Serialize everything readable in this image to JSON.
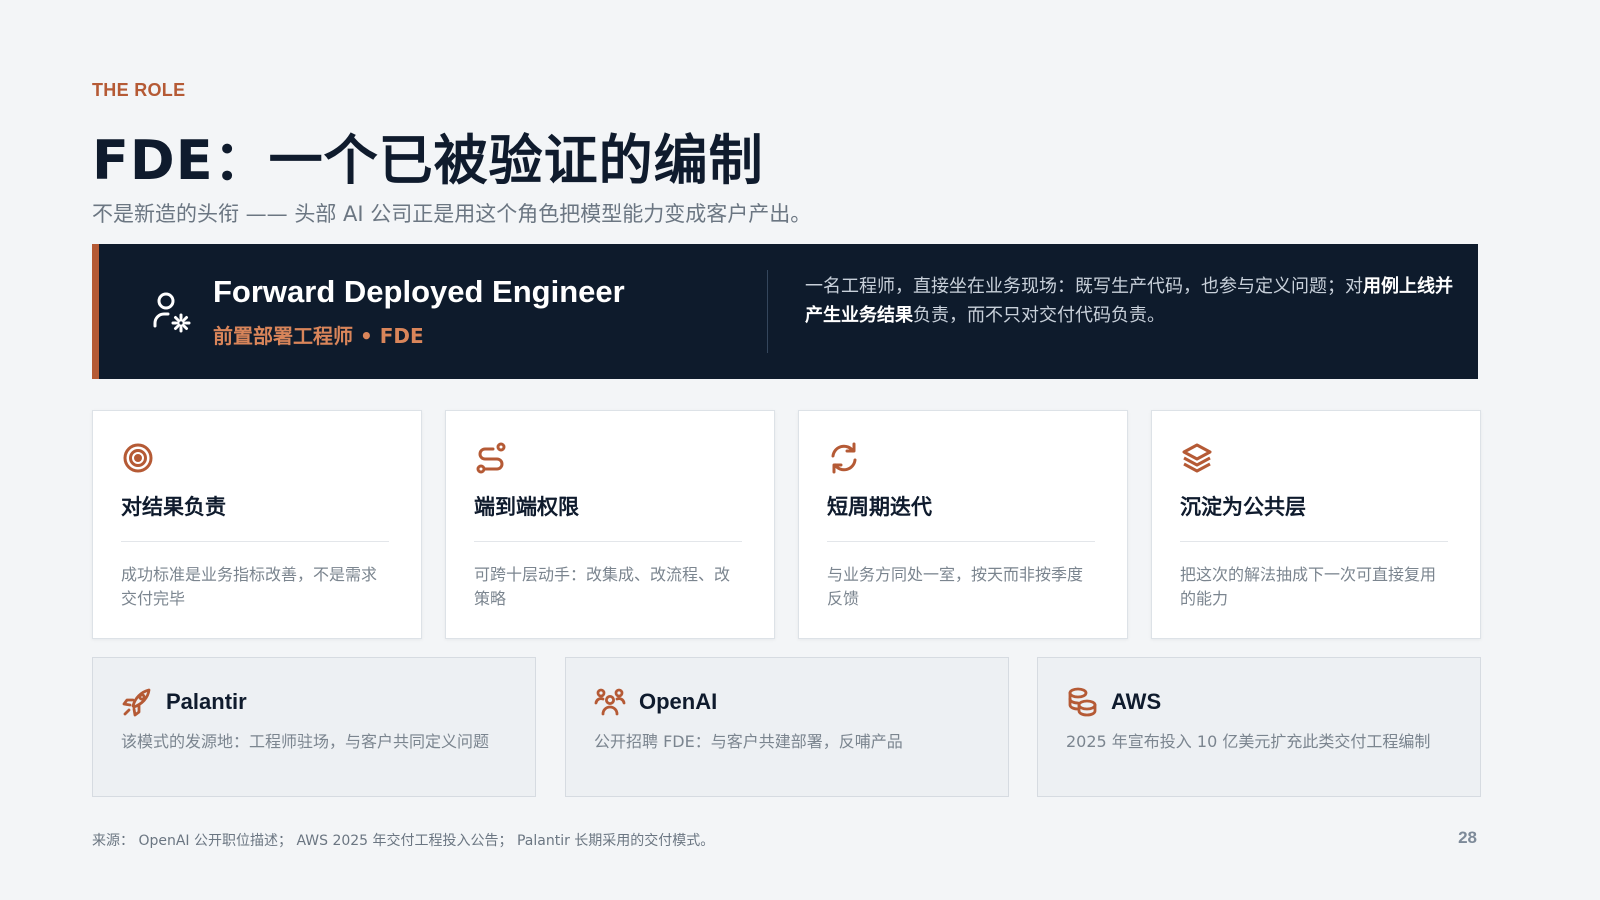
{
  "header": {
    "eyebrow": "THE ROLE",
    "title": "FDE：一个已被验证的编制",
    "subtitle": "不是新造的头衔 —— 头部 AI 公司正是用这个角色把模型能力变成客户产出。"
  },
  "banner": {
    "icon": "user-gear-icon",
    "name": "Forward Deployed Engineer",
    "sub": "前置部署工程师 • FDE",
    "desc_lead": "一名工程师，直接坐在业务现场：既写生产代码，也参与定义问题；对",
    "desc_emph": "用例上线并产生业务结果",
    "desc_tail": "负责，而不只对交付代码负责。"
  },
  "pillars": [
    {
      "icon": "target-icon",
      "title": "对结果负责",
      "desc": "成功标准是业务指标改善，不是需求交付完毕"
    },
    {
      "icon": "route-icon",
      "title": "端到端权限",
      "desc": "可跨十层动手：改集成、改流程、改策略"
    },
    {
      "icon": "refresh-icon",
      "title": "短周期迭代",
      "desc": "与业务方同处一室，按天而非按季度反馈"
    },
    {
      "icon": "layers-icon",
      "title": "沉淀为公共层",
      "desc": "把这次的解法抽成下一次可直接复用的能力"
    }
  ],
  "companies": [
    {
      "icon": "rocket-icon",
      "name": "Palantir",
      "desc": "该模式的发源地：工程师驻场，与客户共同定义问题"
    },
    {
      "icon": "users-icon",
      "name": "OpenAI",
      "desc": "公开招聘 FDE：与客户共建部署，反哺产品"
    },
    {
      "icon": "coins-icon",
      "name": "AWS",
      "desc": "2025 年宣布投入 10 亿美元扩充此类交付工程编制"
    }
  ],
  "footer": {
    "source": "来源： OpenAI 公开职位描述； AWS 2025 年交付工程投入公告； Palantir 长期采用的交付模式。",
    "page": "28"
  },
  "colors": {
    "accent": "#b55a35",
    "accent_light": "#d9855a",
    "navy": "#0e1b2c",
    "background": "#f3f5f7"
  }
}
